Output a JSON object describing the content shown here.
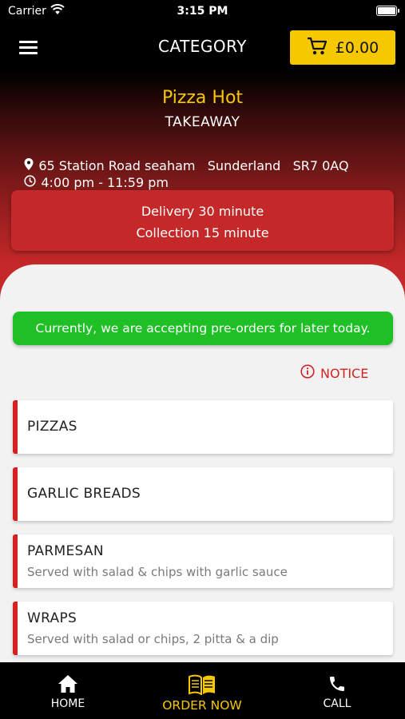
{
  "status_bar": {
    "carrier": "Carrier",
    "time": "3:15 PM"
  },
  "header": {
    "title": "CATEGORY",
    "cart_amount": "£0.00"
  },
  "store": {
    "name": "Pizza Hot",
    "type": "TAKEAWAY",
    "address": "65 Station Road seaham   Sunderland   SR7 0AQ",
    "hours": "4:00 pm - 11:59 pm",
    "delivery": "Delivery 30 minute",
    "collection": "Collection 15 minute"
  },
  "preorder_message": "Currently, we are accepting pre-orders for later today.",
  "notice_label": "NOTICE",
  "categories": [
    {
      "title": "PIZZAS",
      "subtitle": ""
    },
    {
      "title": "GARLIC BREADS",
      "subtitle": ""
    },
    {
      "title": "PARMESAN",
      "subtitle": "Served with salad & chips with garlic sauce"
    },
    {
      "title": "WRAPS",
      "subtitle": "Served with salad or chips, 2 pitta & a dip"
    }
  ],
  "tabs": {
    "home": "HOME",
    "order_now": "ORDER NOW",
    "call": "CALL"
  },
  "colors": {
    "accent_yellow": "#f5c800",
    "brand_red": "#d32222",
    "success_green": "#1fbf26"
  }
}
